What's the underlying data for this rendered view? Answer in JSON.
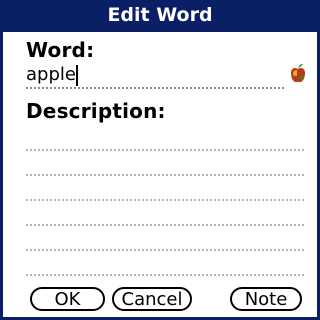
{
  "window": {
    "title": "Edit Word"
  },
  "form": {
    "word_label": "Word:",
    "word_value": "apple",
    "description_label": "Description:",
    "description_value": ""
  },
  "icons": {
    "word_category_icon": "apple-icon"
  },
  "buttons": {
    "ok": "OK",
    "cancel": "Cancel",
    "note": "Note"
  },
  "colors": {
    "titlebar": "#0a1f66",
    "title_text": "#ffffff",
    "apple_green": "#2f8a2f",
    "apple_red": "#b83a1a",
    "apple_yellow": "#e3b12a"
  }
}
